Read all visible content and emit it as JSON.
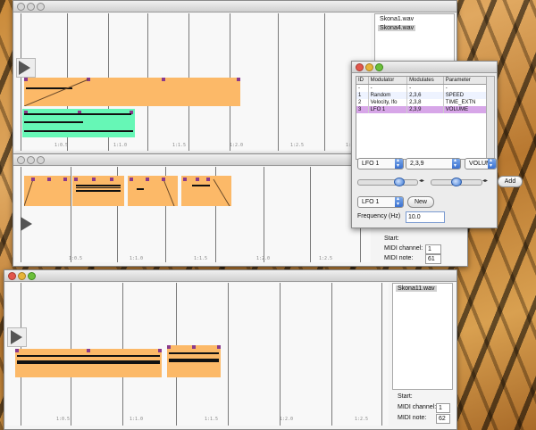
{
  "window1": {
    "files": [
      "Skona1.wav",
      "Skona4.wav"
    ]
  },
  "window3": {
    "file": "Skona11.wav",
    "start_label": "Start:",
    "midi_channel_label": "MIDI channel:",
    "midi_channel_value": "1",
    "midi_note_label": "MIDI note:",
    "midi_note_value": "62"
  },
  "window2": {
    "start_label": "Start:",
    "midi_channel_label": "MIDI channel:",
    "midi_channel_value": "1",
    "midi_note_label": "MIDI note:",
    "midi_note_value": "61"
  },
  "modulator_window": {
    "table": {
      "headers": [
        "ID",
        "Modulator",
        "Modulates",
        "Parameter"
      ],
      "rows": [
        [
          "-",
          "-",
          "-",
          "-"
        ],
        [
          "1",
          "Random",
          "2,3,6",
          "SPEED"
        ],
        [
          "2",
          "Velocity, lfo",
          "2,3,8",
          "TIME_EXTN"
        ],
        [
          "3",
          "LFO 1",
          "2,3,9",
          "VOLUME"
        ]
      ]
    },
    "popups": {
      "modulator": "LFO 1",
      "modulates": "2,3,9",
      "parameter": "VOLUME",
      "type": "LFO 1"
    },
    "add_label": "Add",
    "new_label": "New",
    "frequency_label": "Frequency (Hz)",
    "frequency_value": "10.0"
  },
  "colors": {
    "clip": "#fcb968",
    "clip_alt": "#66f7b6",
    "marker": "#8a3a8a",
    "highlight_row": "#d7a6e8"
  }
}
